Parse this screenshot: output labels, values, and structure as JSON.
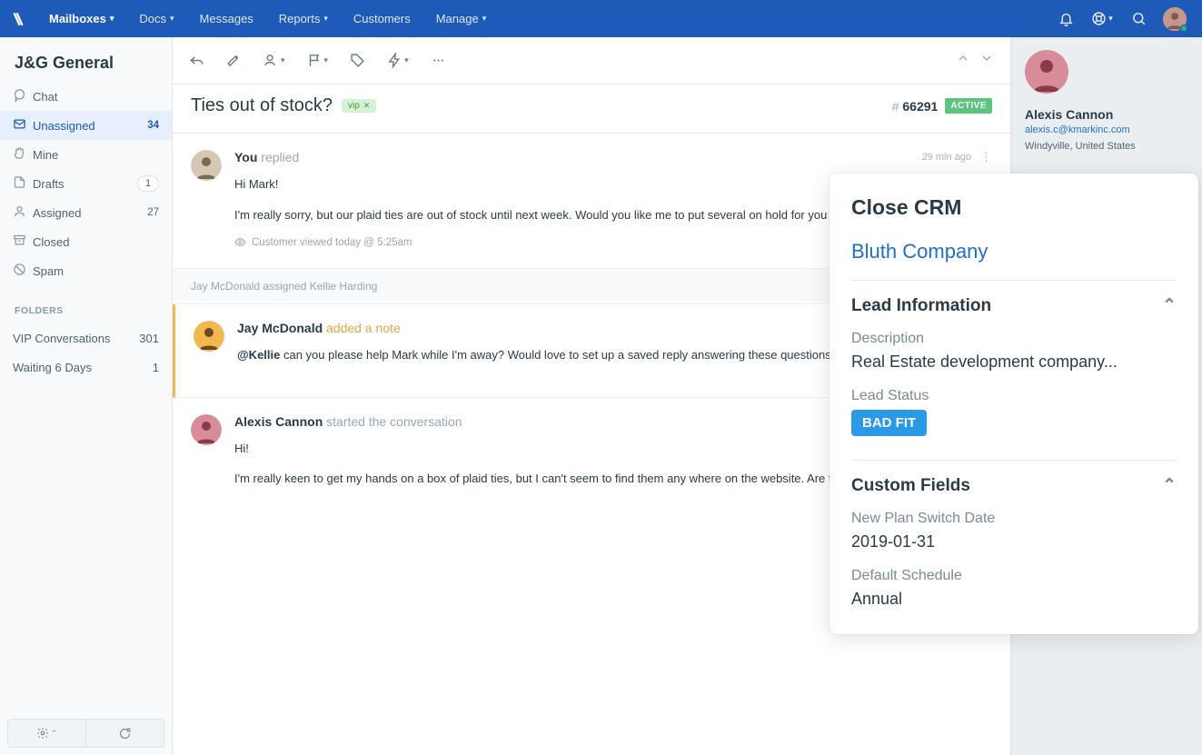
{
  "colors": {
    "brand": "#1e5ab8",
    "link": "#1e6fcc",
    "note_accent": "#e0a940",
    "active_badge": "#5bc47e",
    "bad_fit": "#2a9ae6"
  },
  "topnav": {
    "items": [
      {
        "label": "Mailboxes",
        "dropdown": true,
        "active": true
      },
      {
        "label": "Docs",
        "dropdown": true
      },
      {
        "label": "Messages",
        "dropdown": false
      },
      {
        "label": "Reports",
        "dropdown": true
      },
      {
        "label": "Customers",
        "dropdown": false
      },
      {
        "label": "Manage",
        "dropdown": true
      }
    ]
  },
  "sidebar": {
    "mailbox": "J&G General",
    "items": [
      {
        "icon": "chat-icon",
        "label": "Chat",
        "count": ""
      },
      {
        "icon": "inbox-icon",
        "label": "Unassigned",
        "count": "34",
        "active": true
      },
      {
        "icon": "hand-icon",
        "label": "Mine",
        "count": ""
      },
      {
        "icon": "draft-icon",
        "label": "Drafts",
        "count_pill": "1"
      },
      {
        "icon": "user-icon",
        "label": "Assigned",
        "count": "27"
      },
      {
        "icon": "archive-icon",
        "label": "Closed",
        "count": ""
      },
      {
        "icon": "spam-icon",
        "label": "Spam",
        "count": ""
      }
    ],
    "folders_header": "FOLDERS",
    "folders": [
      {
        "label": "VIP Conversations",
        "count_pill": "301"
      },
      {
        "label": "Waiting 6 Days",
        "count_pill": "1"
      }
    ]
  },
  "conversation": {
    "subject": "Ties out of stock?",
    "tag": "vip",
    "ticket_hash": "#",
    "ticket_number": "66291",
    "status": "ACTIVE",
    "messages": [
      {
        "author": "You",
        "action": "replied",
        "time": "29 min ago",
        "body1": "Hi Mark!",
        "body2": "I'm really sorry, but our plaid ties are out of stock until next week. Would you like me to put several on hold for you when the new stock co",
        "viewed": "Customer viewed today @ 5:25am"
      },
      {
        "author": "Jay McDonald",
        "action": "added a note",
        "note": true,
        "mention": "@Kellie",
        "body": " can you please help Mark while I'm away? Would love to set up a saved reply answering these questions in the future."
      },
      {
        "author": "Alexis Cannon",
        "action": "started the conversation",
        "body1": "Hi!",
        "body2": "I'm really keen to get my hands on a box of plaid ties, but I can't seem to find them any where on the website. Are they in stock?"
      }
    ],
    "assignment_event": "Jay McDonald assigned Kellie Harding"
  },
  "customer": {
    "name": "Alexis Cannon",
    "email": "alexis.c@kmarkinc.com",
    "location": "Windyville, United States"
  },
  "crm": {
    "title": "Close CRM",
    "company": "Bluth Company",
    "lead_info_hdr": "Lead Information",
    "description_label": "Description",
    "description_value": "Real Estate development company...",
    "lead_status_label": "Lead Status",
    "lead_status_value": "BAD FIT",
    "custom_fields_hdr": "Custom Fields",
    "plan_date_label": "New Plan Switch Date",
    "plan_date_value": "2019-01-31",
    "schedule_label": "Default Schedule",
    "schedule_value": "Annual"
  }
}
